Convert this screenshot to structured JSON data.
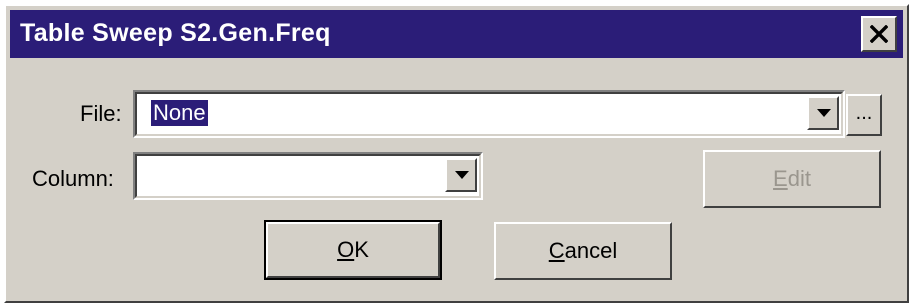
{
  "dialog": {
    "title": "Table Sweep S2.Gen.Freq",
    "close_icon": "close-icon"
  },
  "file": {
    "label": "File:",
    "selected": "None",
    "browse_label": "..."
  },
  "column": {
    "label": "Column:",
    "selected": ""
  },
  "buttons": {
    "edit": {
      "mnemonic": "E",
      "rest": "dit",
      "enabled": false
    },
    "ok": {
      "mnemonic": "O",
      "rest": "K"
    },
    "cancel": {
      "mnemonic": "C",
      "rest": "ancel"
    }
  },
  "colors": {
    "titlebar": "#2b1d78",
    "face": "#d4d0c8",
    "selection": "#2b1d78"
  }
}
